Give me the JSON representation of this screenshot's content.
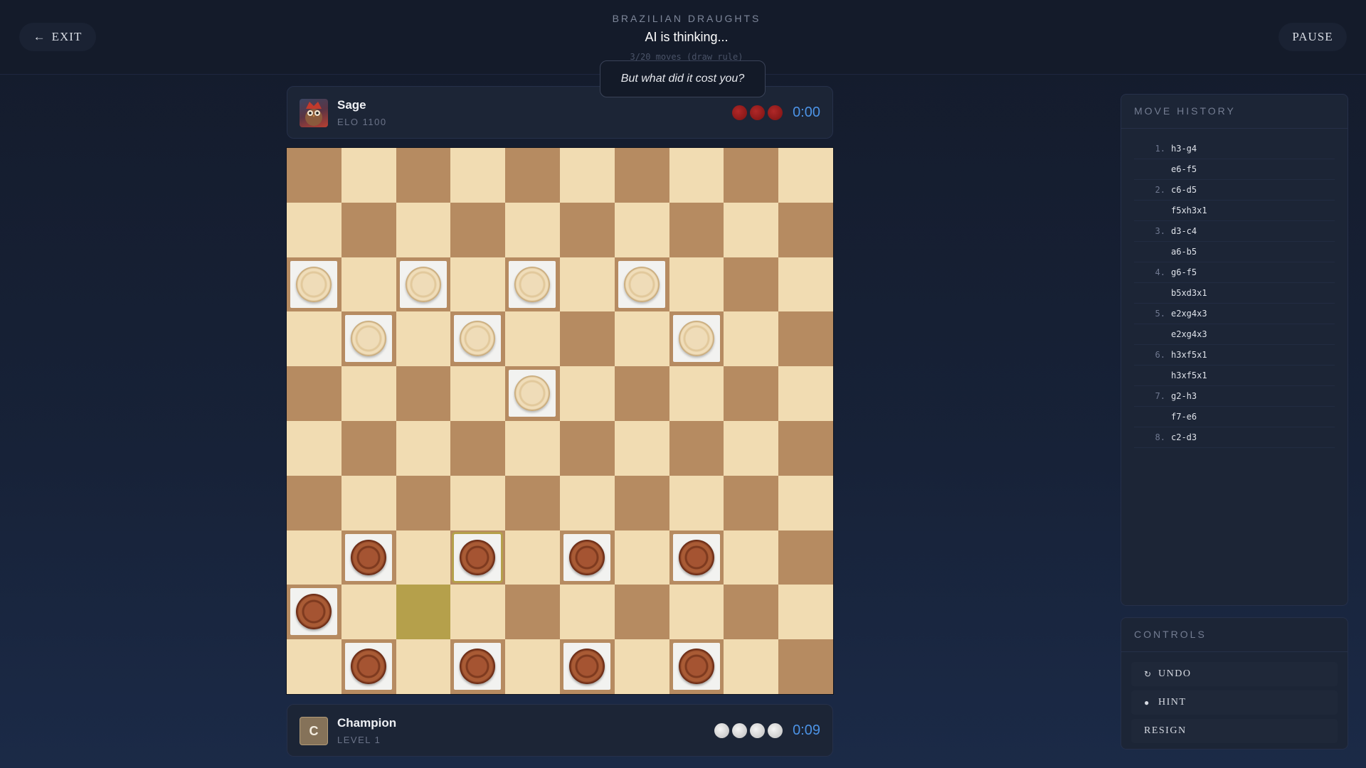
{
  "header": {
    "exit_label": "EXIT",
    "game_name": "BRAZILIAN DRAUGHTS",
    "status": "AI is thinking...",
    "draw_rule": "3/20 moves (draw rule)",
    "pause_label": "PAUSE"
  },
  "tooltip": "But what did it cost you?",
  "opponent": {
    "name": "Sage",
    "sub": "ELO 1100",
    "captured_count": 3,
    "captured_color": "red",
    "clock": "0:00"
  },
  "player": {
    "avatar_letter": "C",
    "name": "Champion",
    "sub": "LEVEL 1",
    "captured_count": 4,
    "captured_color": "white",
    "clock": "0:09"
  },
  "board": {
    "size": 10,
    "light_color": "#f1dcb2",
    "dark_color": "#b68b61",
    "highlight_color": "#b5a04b",
    "highlight_square": "c2",
    "selected_square": "d3",
    "white_pieces": [
      "a8",
      "c8",
      "e8",
      "g8",
      "b7",
      "d7",
      "h7",
      "e6"
    ],
    "red_pieces": [
      "b3",
      "d3",
      "f3",
      "h3",
      "a2",
      "b1",
      "d1",
      "f1",
      "h1"
    ]
  },
  "move_history": {
    "title": "MOVE HISTORY",
    "moves": [
      {
        "num": "1.",
        "move": "h3-g4"
      },
      {
        "num": "",
        "move": "e6-f5"
      },
      {
        "num": "2.",
        "move": "c6-d5"
      },
      {
        "num": "",
        "move": "f5xh3x1"
      },
      {
        "num": "3.",
        "move": "d3-c4"
      },
      {
        "num": "",
        "move": "a6-b5"
      },
      {
        "num": "4.",
        "move": "g6-f5"
      },
      {
        "num": "",
        "move": "b5xd3x1"
      },
      {
        "num": "5.",
        "move": "e2xg4x3"
      },
      {
        "num": "",
        "move": "e2xg4x3"
      },
      {
        "num": "6.",
        "move": "h3xf5x1"
      },
      {
        "num": "",
        "move": "h3xf5x1"
      },
      {
        "num": "7.",
        "move": "g2-h3"
      },
      {
        "num": "",
        "move": "f7-e6"
      },
      {
        "num": "8.",
        "move": "c2-d3"
      }
    ]
  },
  "controls": {
    "title": "CONTROLS",
    "buttons": [
      {
        "label": "UNDO",
        "icon": "undo-icon",
        "glyph": "↻"
      },
      {
        "label": "HINT",
        "icon": "bulb-icon",
        "glyph": "●"
      },
      {
        "label": "RESIGN",
        "icon": "",
        "glyph": ""
      }
    ]
  }
}
